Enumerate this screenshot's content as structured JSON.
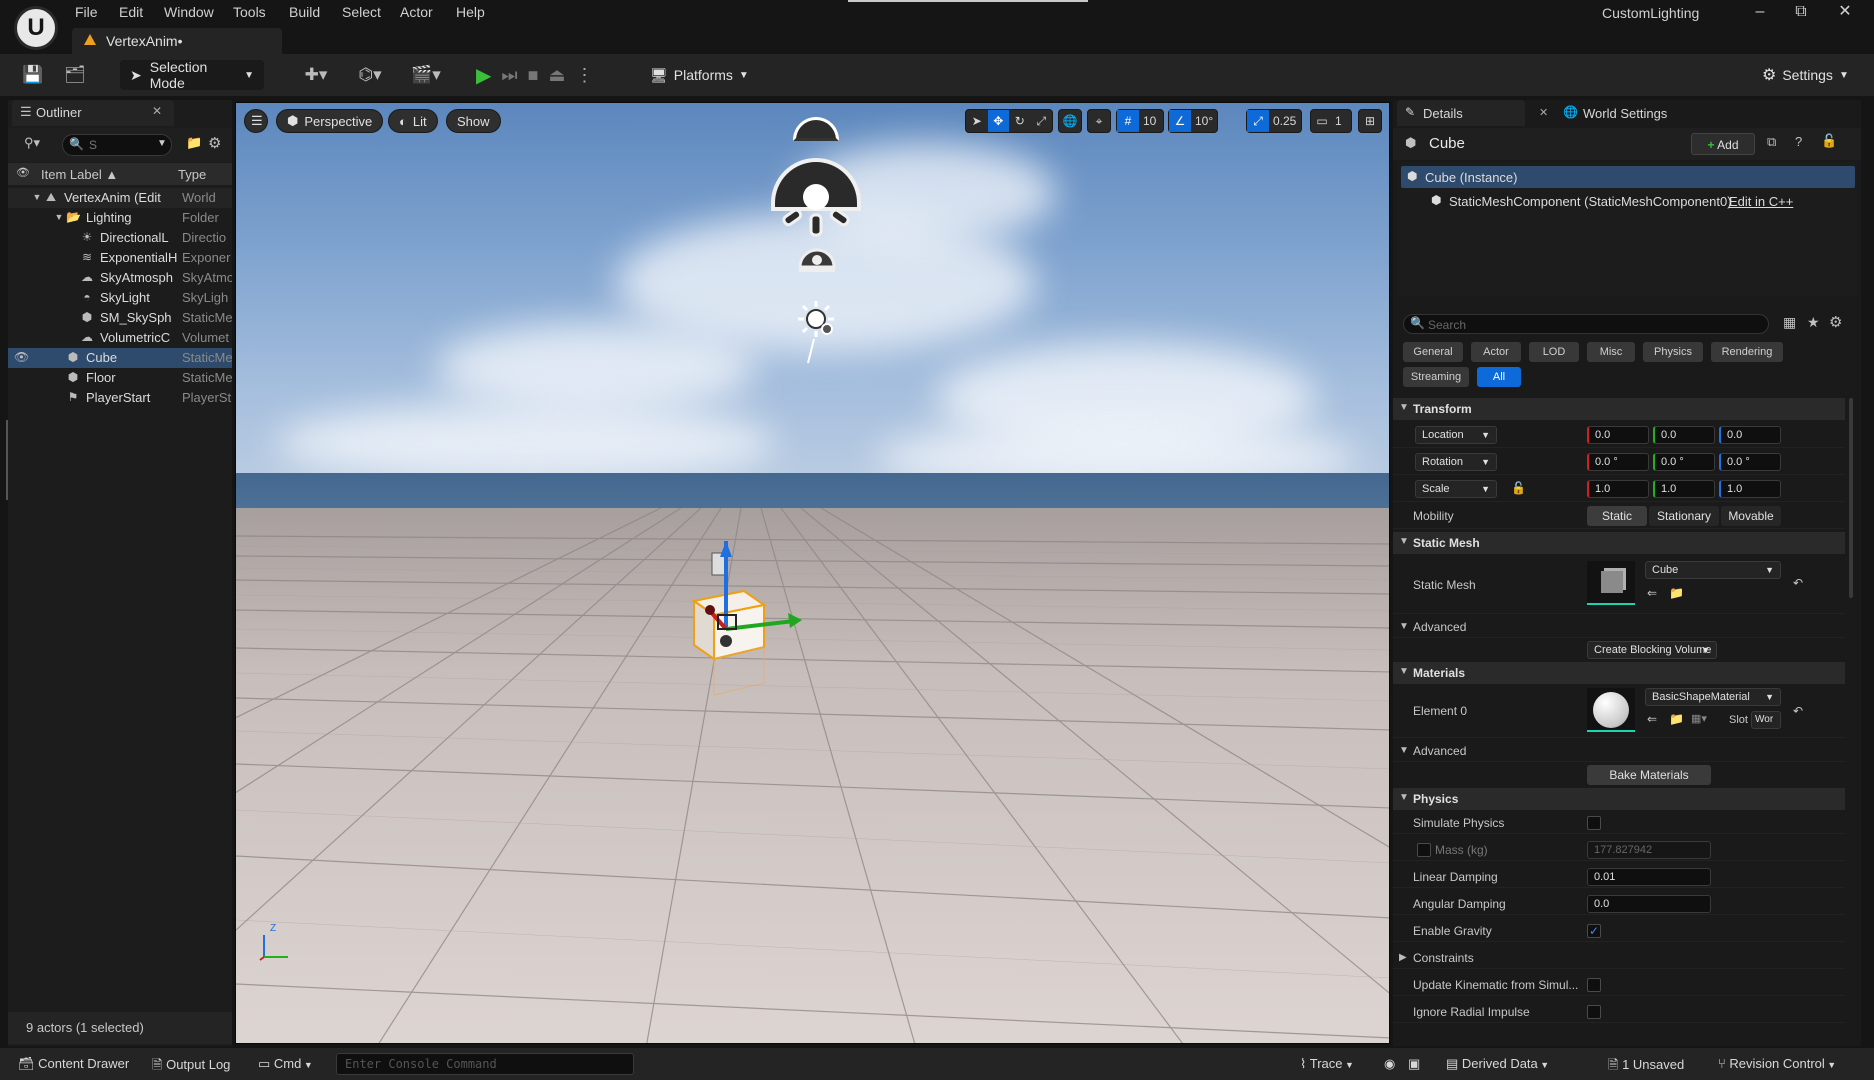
{
  "app": {
    "doc_tab": "VertexAnim•",
    "project_name": "CustomLighting",
    "menu": [
      "File",
      "Edit",
      "Window",
      "Tools",
      "Build",
      "Select",
      "Actor",
      "Help"
    ],
    "window_controls": {
      "minimize": "–",
      "restore": "⧉",
      "close": "✕"
    }
  },
  "toolbar": {
    "mode_label": "Selection Mode",
    "platforms_label": "Platforms",
    "settings_label": "Settings"
  },
  "outliner": {
    "tab_label": "Outliner",
    "search_value": "S",
    "col_label": "Item Label ▲",
    "col_type": "Type",
    "rows": [
      {
        "label": "VertexAnim (Edit",
        "type": "World",
        "icon": "world-icon"
      },
      {
        "label": "Lighting",
        "type": "Folder",
        "icon": "folder-icon"
      },
      {
        "label": "DirectionalL",
        "type": "Directio",
        "icon": "sun-icon"
      },
      {
        "label": "ExponentialH",
        "type": "Exponer",
        "icon": "fog-icon"
      },
      {
        "label": "SkyAtmosph",
        "type": "SkyAtmo",
        "icon": "sky-atmosphere-icon"
      },
      {
        "label": "SkyLight",
        "type": "SkyLigh",
        "icon": "skylight-icon"
      },
      {
        "label": "SM_SkySph",
        "type": "StaticMe",
        "icon": "static-mesh-icon"
      },
      {
        "label": "VolumetricC",
        "type": "Volumet",
        "icon": "cloud-icon"
      },
      {
        "label": "Cube",
        "type": "StaticMe",
        "icon": "static-mesh-icon"
      },
      {
        "label": "Floor",
        "type": "StaticMe",
        "icon": "static-mesh-icon"
      },
      {
        "label": "PlayerStart",
        "type": "PlayerSt",
        "icon": "player-start-icon"
      }
    ],
    "status": "9 actors (1 selected)"
  },
  "viewport": {
    "perspective_label": "Perspective",
    "lit_label": "Lit",
    "show_label": "Show",
    "grid_snap": "10",
    "rot_snap": "10°",
    "scale_snap": "0.25",
    "cam_speed": "1",
    "axis_x": "",
    "axis_z": "Z"
  },
  "details": {
    "tab_details": "Details",
    "tab_world": "World Settings",
    "actor_name": "Cube",
    "add_label": "Add",
    "instance_label": "Cube (Instance)",
    "component_label": "StaticMeshComponent (StaticMeshComponent0)",
    "edit_cpp": "Edit in C++",
    "search_placeholder": "Search",
    "filters_row1": [
      "General",
      "Actor",
      "LOD",
      "Misc",
      "Physics",
      "Rendering"
    ],
    "filters_row2": [
      "Streaming",
      "All"
    ],
    "transform": {
      "section": "Transform",
      "location_label": "Location",
      "rotation_label": "Rotation",
      "scale_label": "Scale",
      "location": [
        "0.0",
        "0.0",
        "0.0"
      ],
      "rotation": [
        "0.0 °",
        "0.0 °",
        "0.0 °"
      ],
      "scale": [
        "1.0",
        "1.0",
        "1.0"
      ],
      "mobility_label": "Mobility",
      "mobility_opts": [
        "Static",
        "Stationary",
        "Movable"
      ]
    },
    "static_mesh": {
      "section": "Static Mesh",
      "label": "Static Mesh",
      "value": "Cube",
      "advanced": "Advanced",
      "blocking_volume": "Create Blocking Volume"
    },
    "materials": {
      "section": "Materials",
      "element_label": "Element 0",
      "value": "BasicShapeMaterial",
      "slot_label": "Slot",
      "slot_value": "Wor",
      "advanced": "Advanced",
      "bake": "Bake Materials"
    },
    "physics": {
      "section": "Physics",
      "simulate": "Simulate Physics",
      "mass_label": "Mass (kg)",
      "mass_value": "177.827942",
      "linear_label": "Linear Damping",
      "linear_value": "0.01",
      "angular_label": "Angular Damping",
      "angular_value": "0.0",
      "gravity_label": "Enable Gravity",
      "constraints": "Constraints",
      "kinematic_label": "Update Kinematic from Simul...",
      "radial_label": "Ignore Radial Impulse"
    }
  },
  "bottom": {
    "content_drawer": "Content Drawer",
    "output_log": "Output Log",
    "cmd": "Cmd",
    "console_placeholder": "Enter Console Command",
    "trace": "Trace",
    "derived_data": "Derived Data",
    "unsaved": "1 Unsaved",
    "revision_control": "Revision Control"
  },
  "colors": {
    "accent": "#0e6ad8",
    "selection": "#2e4a6d",
    "gizmo_x": "#d02020",
    "gizmo_y": "#20b020",
    "gizmo_z": "#2070e0"
  }
}
